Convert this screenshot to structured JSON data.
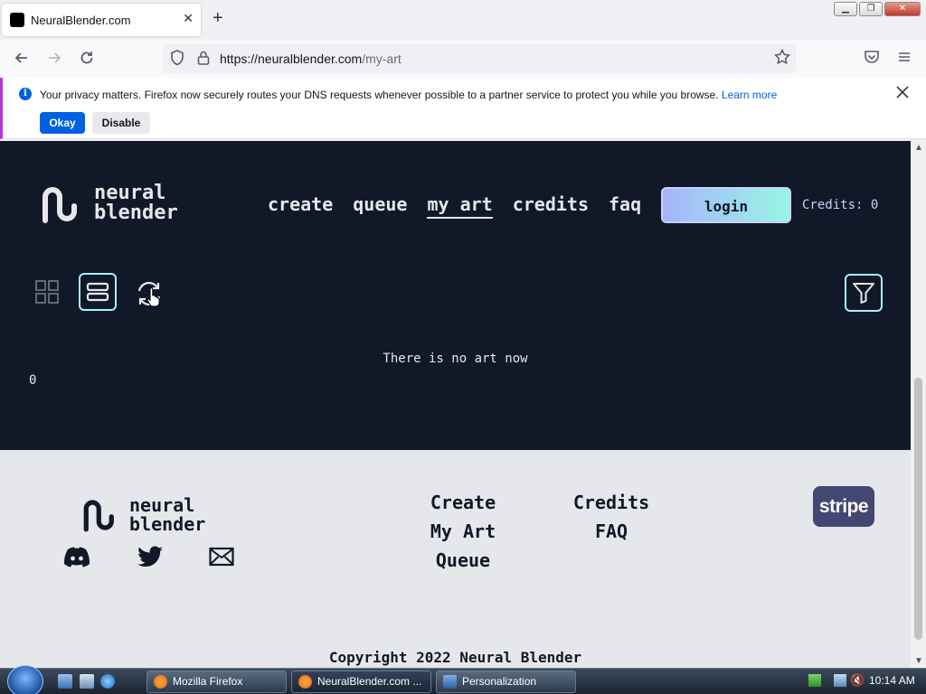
{
  "browser": {
    "tab_title": "NeuralBlender.com",
    "tab_close": "✕",
    "new_tab": "+",
    "url_host": "https://neuralblender.com",
    "url_path": "/my-art",
    "win_min": "▁",
    "win_max": "❐",
    "win_close": "✕"
  },
  "infobar": {
    "message": "Your privacy matters. Firefox now securely routes your DNS requests whenever possible to a partner service to protect you while you browse.",
    "learn_more": "Learn more",
    "okay": "Okay",
    "disable": "Disable",
    "info_glyph": "i"
  },
  "site": {
    "logo_line1": "neural",
    "logo_line2": "blender",
    "nav": [
      "create",
      "queue",
      "my art",
      "credits",
      "faq"
    ],
    "login": "login",
    "credits_label": "Credits: 0",
    "empty_message": "There is no art now",
    "count": "0"
  },
  "footer": {
    "col1": [
      "Create",
      "My Art",
      "Queue"
    ],
    "col2": [
      "Credits",
      "FAQ"
    ],
    "stripe": "stripe",
    "copyright": "Copyright 2022 Neural Blender"
  },
  "taskbar": {
    "tasks": [
      "Mozilla Firefox",
      "NeuralBlender.com ...",
      "Personalization"
    ],
    "clock": "10:14 AM"
  },
  "colors": {
    "hero_bg": "#111827",
    "footer_bg": "#e5e7eb",
    "accent": "#a5f3fc",
    "firefox_blue": "#0061e0"
  }
}
